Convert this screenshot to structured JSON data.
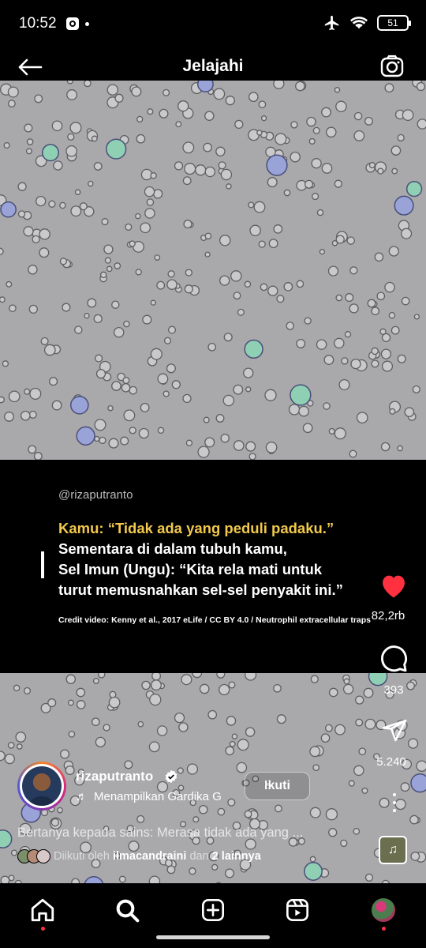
{
  "status_bar": {
    "time": "10:52",
    "battery": "51",
    "icons": [
      "app-notification-icon",
      "dot-icon",
      "airplane-icon",
      "wifi-icon",
      "battery-icon"
    ]
  },
  "header": {
    "title": "Jelajahi",
    "back_icon": "arrow-left-icon",
    "camera_icon": "camera-icon"
  },
  "post": {
    "handle": "@rizaputranto",
    "quote_line1": "Kamu: “Tidak ada yang peduli padaku.”",
    "quote_line2": "Sementara di dalam tubuh kamu,",
    "quote_line3": "Sel Imun (Ungu): “Kita rela mati untuk",
    "quote_line4": "turut memusnahkan sel-sel penyakit ini.”",
    "credit": "Credit video: Kenny et al., 2017 eLife / CC BY 4.0 / Neutrophil extracellular traps",
    "highlight_color": "#f2c94c"
  },
  "actions": {
    "like_count": "82,2rb",
    "comment_count": "393",
    "share_count": "5.240",
    "like_color": "#ff3040"
  },
  "author": {
    "name": "rizaputranto",
    "music": "Menampilkan Gardika G",
    "follow_label": "Ikuti"
  },
  "description": "Bertanya kepada sains: Merasa tidak ada yang ...",
  "followed": {
    "prefix": "Diikuti oleh",
    "user": "ilmacandraini",
    "middle": "dan",
    "others": "2 lainnya"
  },
  "bottom_nav": {
    "items": [
      "home-icon",
      "search-icon",
      "create-icon",
      "reels-icon",
      "profile-avatar"
    ]
  }
}
